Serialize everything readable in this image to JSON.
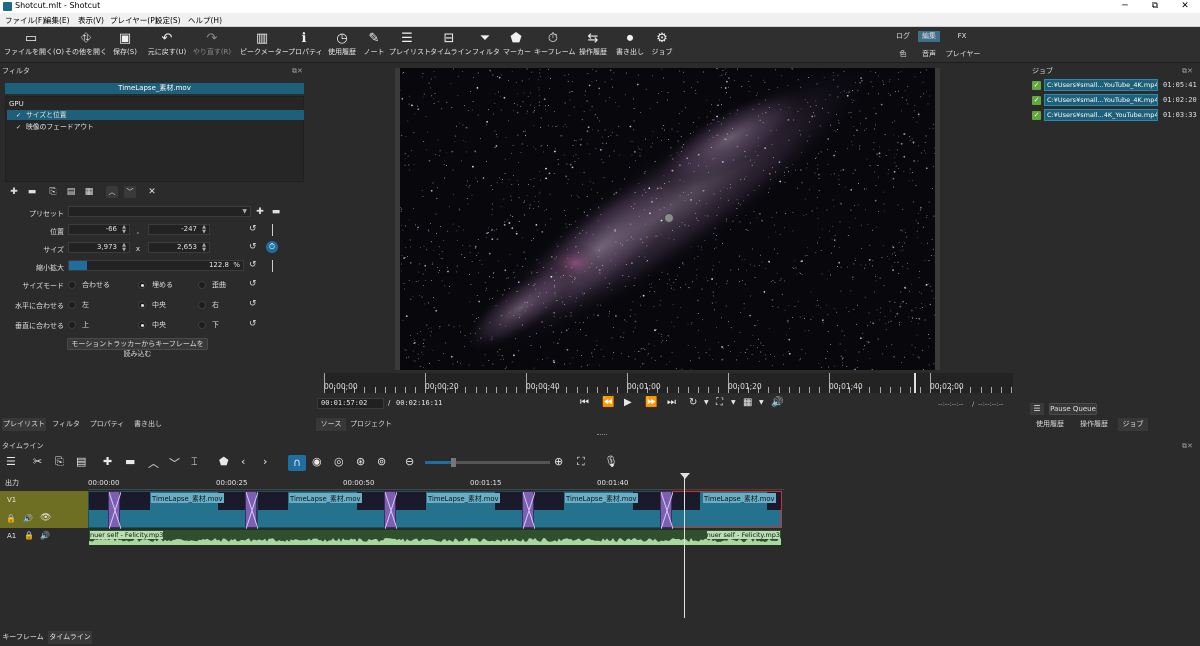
{
  "window": {
    "title": "Shotcut.mlt - Shotcut",
    "minimize": "─",
    "maximize": "⧉",
    "close": "✕"
  },
  "menu": [
    "ファイル(F)",
    "編集(E)",
    "表示(V)",
    "プレイヤー(P)",
    "設定(S)",
    "ヘルプ(H)"
  ],
  "toolbar": [
    {
      "label": "ファイルを開く(O)",
      "icon": "folder-open-icon",
      "glyph": "▭"
    },
    {
      "label": "その他を開く",
      "icon": "open-other-icon",
      "glyph": "⛗"
    },
    {
      "label": "保存(S)",
      "icon": "save-icon",
      "glyph": "▣"
    },
    {
      "label": "元に戻す(U)",
      "icon": "undo-icon",
      "glyph": "↶"
    },
    {
      "label": "やり直す(R)",
      "icon": "redo-icon",
      "glyph": "↷"
    },
    {
      "label": "ピークメーター",
      "icon": "peak-meter-icon",
      "glyph": "▥"
    },
    {
      "label": "プロパティ",
      "icon": "info-icon",
      "glyph": "ℹ"
    },
    {
      "label": "使用履歴",
      "icon": "clock-icon",
      "glyph": "◷"
    },
    {
      "label": "ノート",
      "icon": "note-icon",
      "glyph": "✎"
    },
    {
      "label": "プレイリスト",
      "icon": "playlist-icon",
      "glyph": "☰"
    },
    {
      "label": "タイムライン",
      "icon": "timeline-icon",
      "glyph": "⊟"
    },
    {
      "label": "フィルタ",
      "icon": "filter-icon",
      "glyph": "⏷"
    },
    {
      "label": "マーカー",
      "icon": "marker-icon",
      "glyph": "⬟"
    },
    {
      "label": "キーフレーム",
      "icon": "stopwatch-icon",
      "glyph": "⏱"
    },
    {
      "label": "操作履歴",
      "icon": "history-icon",
      "glyph": "⇆"
    },
    {
      "label": "書き出し",
      "icon": "export-icon",
      "glyph": "⏺"
    },
    {
      "label": "ジョブ",
      "icon": "gear-icon",
      "glyph": "⚙"
    }
  ],
  "layouts": {
    "log": "ログ",
    "edit": "編集",
    "fx": "FX",
    "color": "色",
    "audio": "音声",
    "player": "プレイヤー"
  },
  "filters_panel": {
    "title": "フィルタ",
    "clip_name": "TimeLapse_素材.mov",
    "group": "GPU",
    "items": [
      "サイズと位置",
      "映像のフェードアウト"
    ],
    "preset_label": "プリセット",
    "position_label": "位置",
    "position_x": "-66",
    "position_sep": ",",
    "position_y": "-247",
    "size_label": "サイズ",
    "size_w": "3,973",
    "size_sep": "x",
    "size_h": "2,653",
    "zoom_label": "縮小拡大",
    "zoom_value": "122.8",
    "zoom_unit": "%",
    "size_mode_label": "サイズモード",
    "size_modes": [
      "合わせる",
      "埋める",
      "歪曲"
    ],
    "halign_label": "水平に合わせる",
    "haligns": [
      "左",
      "中央",
      "右"
    ],
    "valign_label": "垂直に合わせる",
    "valigns": [
      "上",
      "中央",
      "下"
    ],
    "tracker_button": "モーショントラッカーからキーフレームを読み込む"
  },
  "left_tabs": [
    "プレイリスト",
    "フィルタ",
    "プロパティ",
    "書き出し"
  ],
  "player": {
    "ruler_ticks": [
      "00:00;00",
      "00:00;20",
      "00:00;40",
      "00:01;00",
      "00:01;20",
      "00:01;40",
      "00:02;00"
    ],
    "current_tc": "00:01:57:02",
    "tc_sep": "/",
    "total_tc": "00:02:16:11",
    "in_point": "--:--:--:--",
    "out_point": "--:--:--:--",
    "tabs": [
      "ソース",
      "プロジェクト"
    ]
  },
  "jobs_panel": {
    "title": "ジョブ",
    "jobs": [
      {
        "name": "C:¥Users¥small...YouTube_4K.mp4",
        "time": "01:05:41"
      },
      {
        "name": "C:¥Users¥small...YouTube_4K.mp4",
        "time": "01:02:20"
      },
      {
        "name": "C:¥Users¥small...4K_YouTube.mp4",
        "time": "01:03:33"
      }
    ],
    "pause_label": "Pause Queue",
    "tabs": [
      "使用履歴",
      "操作履歴",
      "ジョブ"
    ]
  },
  "timeline": {
    "title": "タイムライン",
    "output_label": "出力",
    "ruler": [
      "00:00:00",
      "00:00:25",
      "00:00:50",
      "00:01:15",
      "00:01:40"
    ],
    "video_track": "V1",
    "audio_track": "A1",
    "clips": [
      "TimeLapse_素材.mov",
      "TimeLapse_素材.mov",
      "TimeLapse_素材.mov",
      "TimeLapse_素材.mov",
      "TimeLapse_素材.mov"
    ],
    "audio_clip_start": "nuer self - Felicity.mp3",
    "audio_clip_end": "nuer self - Felicity.mp3"
  },
  "bottom_tabs": [
    "キーフレーム",
    "タイムライン"
  ],
  "colors": {
    "accent": "#1e5f7a",
    "track_video": "#25728f",
    "transition": "#7a5fb3",
    "audio_wave": "#a8d8a0",
    "header_olive": "#7a7a2a"
  }
}
